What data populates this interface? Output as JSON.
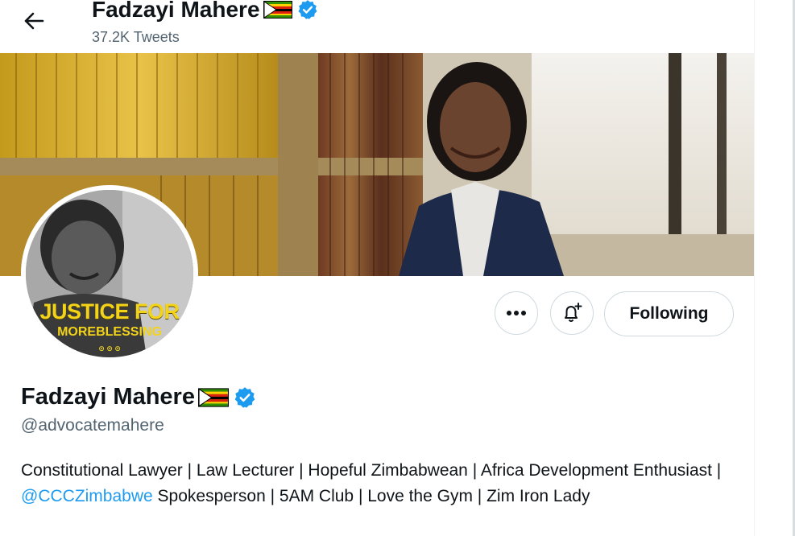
{
  "header": {
    "back_label": "Back",
    "name": "Fadzayi Mahere",
    "tweet_count": "37.2K Tweets"
  },
  "avatar": {
    "line1": "JUSTICE FOR",
    "line2": "MOREBLESSING",
    "line3": "⊙ ⊙ ⊙"
  },
  "actions": {
    "more_icon": "more-horizontal-icon",
    "notify_icon": "bell-plus-icon",
    "following_label": "Following"
  },
  "profile": {
    "name": "Fadzayi Mahere",
    "handle": "@advocatemahere",
    "bio_part1": "Constitutional Lawyer | Law Lecturer | Hopeful Zimbabwean | Africa Development Enthusiast | ",
    "bio_mention": "@CCCZimbabwe",
    "bio_part2": " Spokesperson | 5AM Club | Love the Gym | Zim Iron Lady"
  },
  "colors": {
    "accent": "#1d9bf0",
    "secondary_text": "#536471",
    "border": "#cfd9de"
  }
}
